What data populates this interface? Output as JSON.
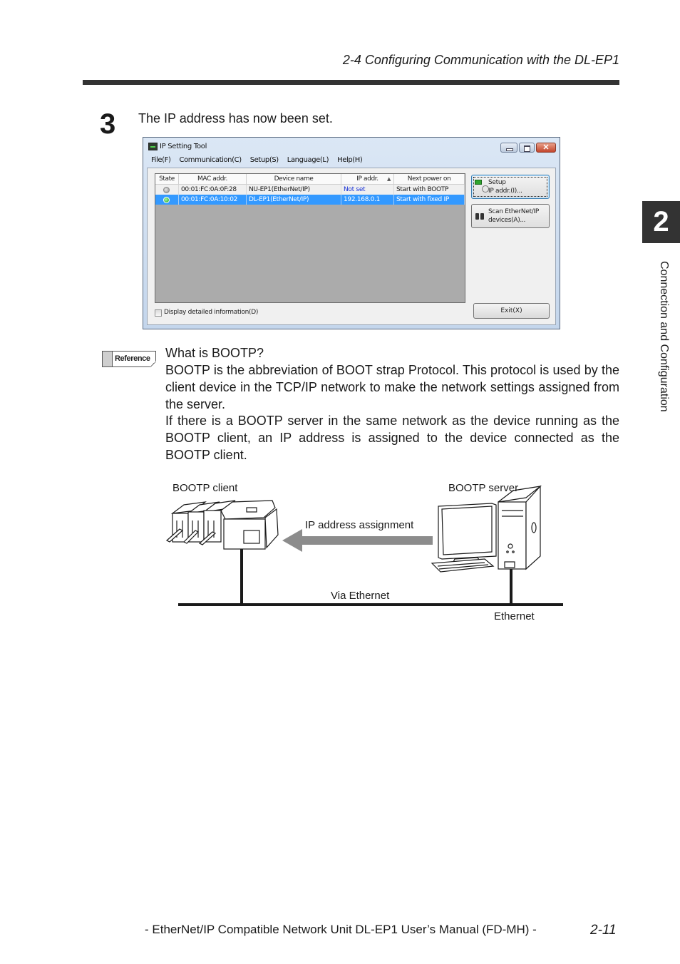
{
  "header": {
    "running_title": "2-4 Configuring Communication with the DL-EP1"
  },
  "step": {
    "number": "3",
    "text": "The IP address has now been set."
  },
  "dialog": {
    "title": "IP Setting Tool",
    "menu": [
      "File(F)",
      "Communication(C)",
      "Setup(S)",
      "Language(L)",
      "Help(H)"
    ],
    "close_glyph": "✕",
    "columns": [
      "State",
      "MAC addr.",
      "Device name",
      "IP addr.",
      "Next power on"
    ],
    "sort_indicator": "▲",
    "rows": [
      {
        "state": "gray",
        "mac": "00:01:FC:0A:0F:28",
        "device": "NU-EP1(EtherNet/IP)",
        "ip": "Not set",
        "next": "Start with BOOTP",
        "selected": false
      },
      {
        "state": "green",
        "mac": "00:01:FC:0A:10:02",
        "device": "DL-EP1(EtherNet/IP)",
        "ip": "192.168.0.1",
        "next": "Start with fixed IP",
        "selected": true
      }
    ],
    "buttons": {
      "setup_line1": "Setup",
      "setup_line2": "IP addr.(I)...",
      "scan_line1": "Scan EtherNet/IP",
      "scan_line2": "devices(A)...",
      "exit": "Exit(X)"
    },
    "checkbox": {
      "label": "Display detailed information(D)",
      "checked": false
    }
  },
  "reference": {
    "badge": "Reference",
    "title": "What is BOOTP?",
    "paragraphs": [
      "BOOTP is the abbreviation of BOOT strap Protocol. This protocol is used by the client device in the TCP/IP network to make the network settings assigned from the server.",
      "If there is a BOOTP server in the same network as the device running as the BOOTP client, an IP address is assigned to the device connected as the BOOTP client."
    ]
  },
  "diagram": {
    "client_label": "BOOTP client",
    "server_label": "BOOTP server",
    "arrow_label": "IP address assignment",
    "via_label": "Via Ethernet",
    "network_label": "Ethernet"
  },
  "side": {
    "chapter_number": "2",
    "chapter_title": "Connection and Configuration"
  },
  "footer": {
    "manual_title": "- EtherNet/IP Compatible Network Unit DL-EP1 User’s Manual (FD-MH) -",
    "page_number": "2-11"
  }
}
